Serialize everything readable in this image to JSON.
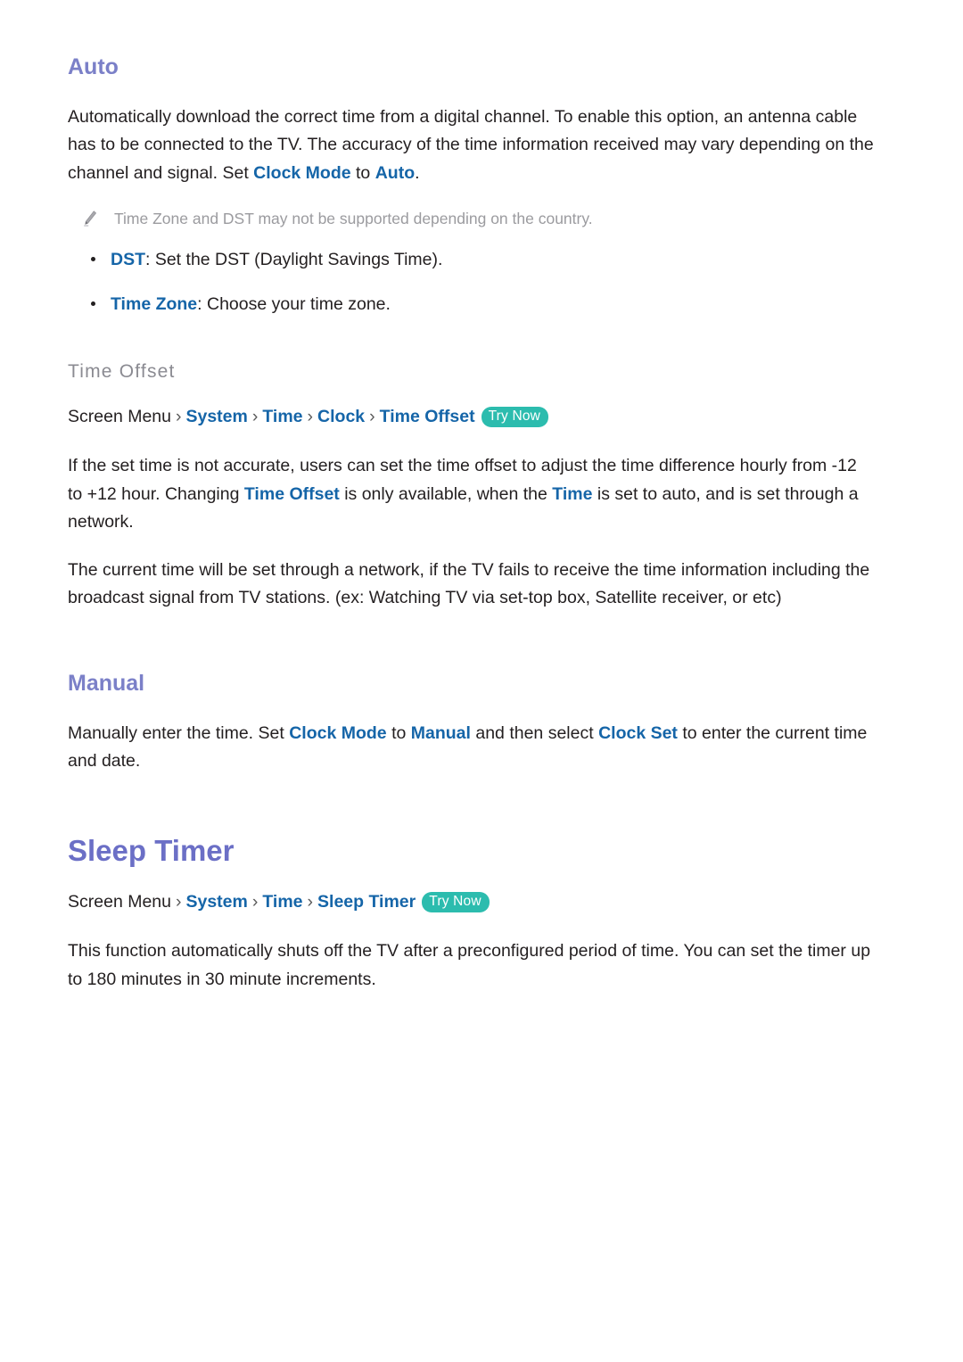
{
  "sections": {
    "auto": {
      "heading": "Auto",
      "paragraph_1": "Automatically download the correct time from a digital channel. To enable this option, an antenna cable has to be connected to the TV. The accuracy of the time information received may vary depending on the channel and signal. Set ",
      "paragraph_1_link_1": "Clock Mode",
      "paragraph_1_mid": " to ",
      "paragraph_1_link_2": "Auto",
      "paragraph_1_end": ".",
      "note": "Time Zone and DST may not be supported depending on the country.",
      "note_icon": "pencil-icon",
      "bullets": [
        {
          "term": "DST",
          "text": ": Set the DST (Daylight Savings Time)."
        },
        {
          "term": "Time Zone",
          "text": ": Choose your time zone."
        }
      ]
    },
    "time_offset": {
      "heading": "Time Offset",
      "breadcrumb": {
        "root": "Screen Menu",
        "separator": "›",
        "crumbs": [
          "System",
          "Time",
          "Clock",
          "Time Offset"
        ],
        "badge": "Try Now"
      },
      "paragraph_1_a": "If the set time is not accurate, users can set the time offset to adjust the time difference hourly from -12 to +12 hour. Changing ",
      "paragraph_1_link_1": "Time Offset",
      "paragraph_1_b": " is only available, when the ",
      "paragraph_1_link_2": "Time",
      "paragraph_1_c": " is set to auto, and is set through a network.",
      "paragraph_2": "The current time will be set through a network, if the TV fails to receive the time information including the broadcast signal from TV stations. (ex: Watching TV via set-top box, Satellite receiver, or etc)"
    },
    "manual": {
      "heading": "Manual",
      "paragraph_1_a": "Manually enter the time. Set ",
      "paragraph_1_link_1": "Clock Mode",
      "paragraph_1_b": " to ",
      "paragraph_1_link_2": "Manual",
      "paragraph_1_c": " and then select ",
      "paragraph_1_link_3": "Clock Set",
      "paragraph_1_d": " to enter the current time and date."
    },
    "sleep_timer": {
      "heading": "Sleep Timer",
      "breadcrumb": {
        "root": "Screen Menu",
        "separator": "›",
        "crumbs": [
          "System",
          "Time",
          "Sleep Timer"
        ],
        "badge": "Try Now"
      },
      "paragraph_1": "This function automatically shuts off the TV after a preconfigured period of time. You can set the timer up to 180 minutes in 30 minute increments."
    }
  },
  "colors": {
    "heading_purple": "#7b80c8",
    "chapter_purple": "#6b6fc6",
    "link_blue": "#1565a8",
    "badge_teal": "#2cbcae",
    "note_gray": "#9b9b9f",
    "subheading_gray": "#8b8b92",
    "body_black": "#231f20",
    "background": "#ffffff"
  }
}
